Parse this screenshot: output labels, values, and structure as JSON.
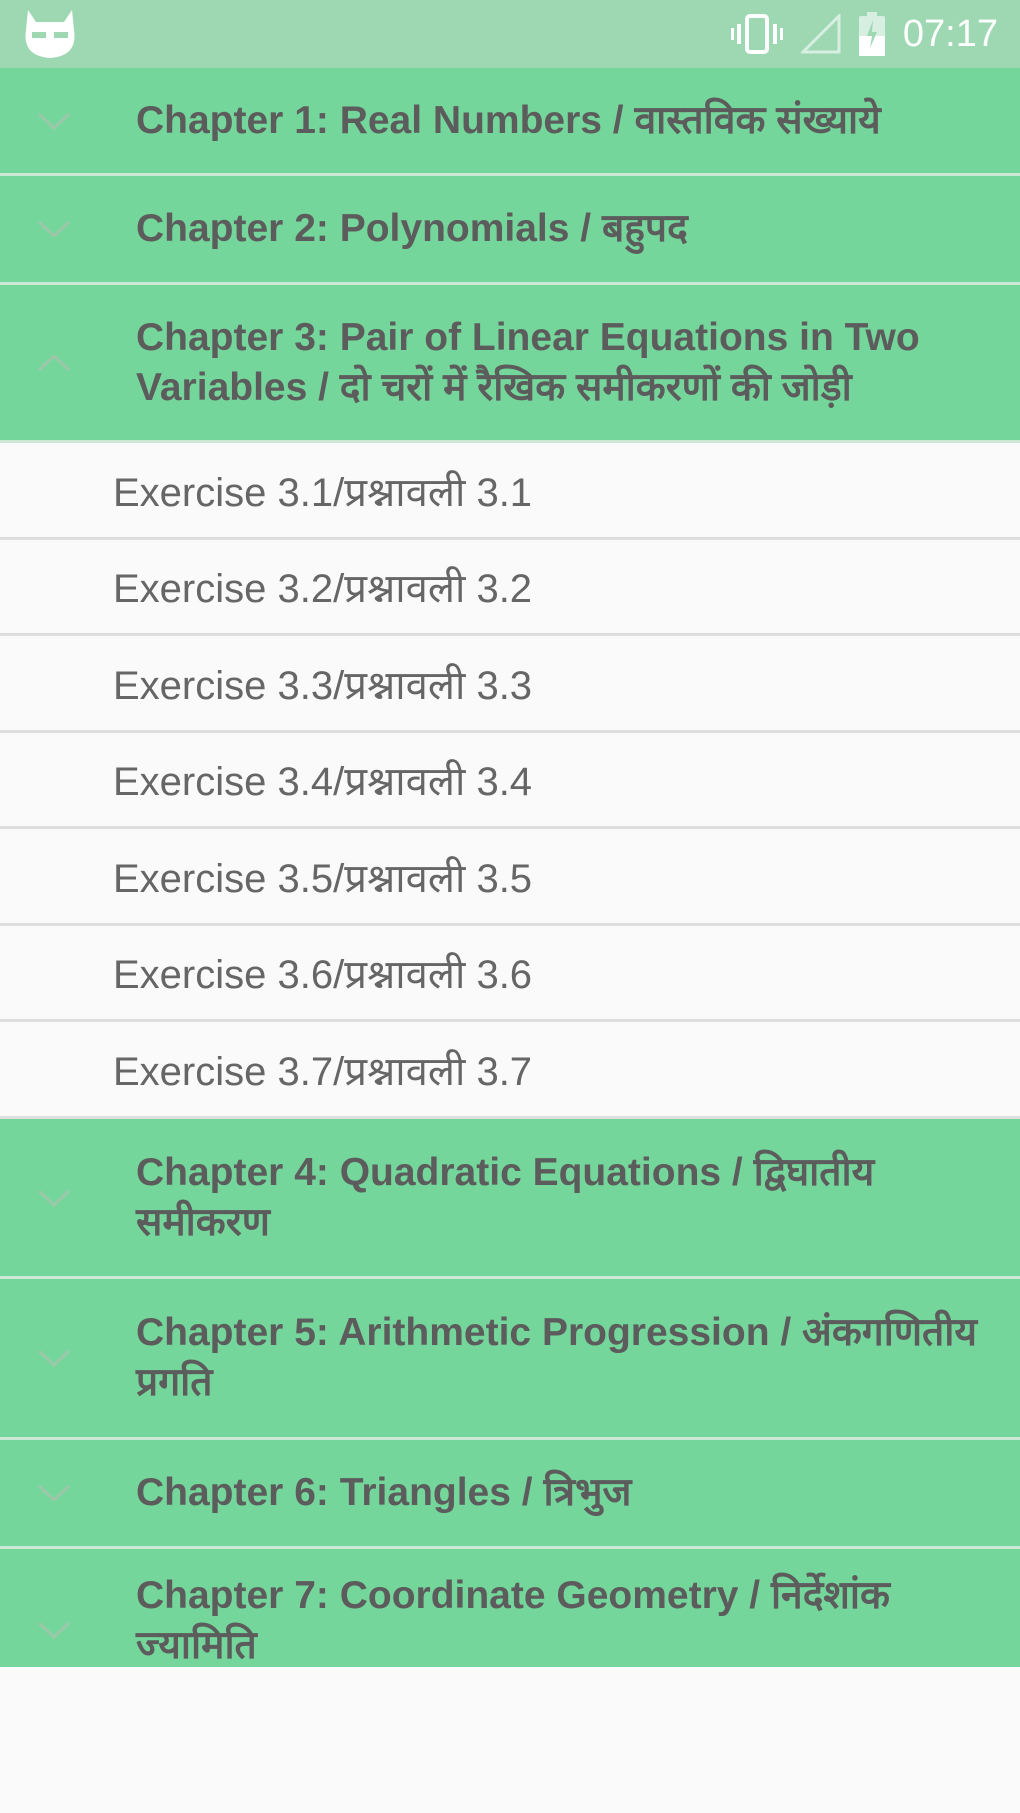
{
  "status_bar": {
    "time": "07:17",
    "icons": [
      "cat-icon",
      "vibrate-icon",
      "signal-icon",
      "battery-icon"
    ]
  },
  "colors": {
    "status_bar": "#9ed8b3",
    "chapter_bg": "#75d69b",
    "chapter_text": "#5c5c5c",
    "exercise_text": "#666666"
  },
  "chapters": [
    {
      "title": "Chapter 1: Real Numbers / वास्तविक संख्याये",
      "expanded": false
    },
    {
      "title": "Chapter 2: Polynomials / बहुपद",
      "expanded": false
    },
    {
      "title": "Chapter 3: Pair of Linear Equations in Two Variables / दो चरों में रैखिक समीकरणों की जोड़ी",
      "expanded": true,
      "exercises": [
        "Exercise 3.1/प्रश्नावली 3.1",
        "Exercise 3.2/प्रश्नावली 3.2",
        "Exercise 3.3/प्रश्नावली 3.3",
        "Exercise 3.4/प्रश्नावली 3.4",
        "Exercise 3.5/प्रश्नावली 3.5",
        "Exercise 3.6/प्रश्नावली 3.6",
        "Exercise 3.7/प्रश्नावली 3.7"
      ]
    },
    {
      "title": "Chapter 4: Quadratic Equations / द्विघातीय समीकरण",
      "expanded": false
    },
    {
      "title": "Chapter 5: Arithmetic Progression / अंकगणितीय प्रगति",
      "expanded": false
    },
    {
      "title": "Chapter 6: Triangles / त्रिभुज",
      "expanded": false
    },
    {
      "title": "Chapter 7: Coordinate Geometry /  निर्देशांक ज्यामिति",
      "expanded": false
    }
  ]
}
